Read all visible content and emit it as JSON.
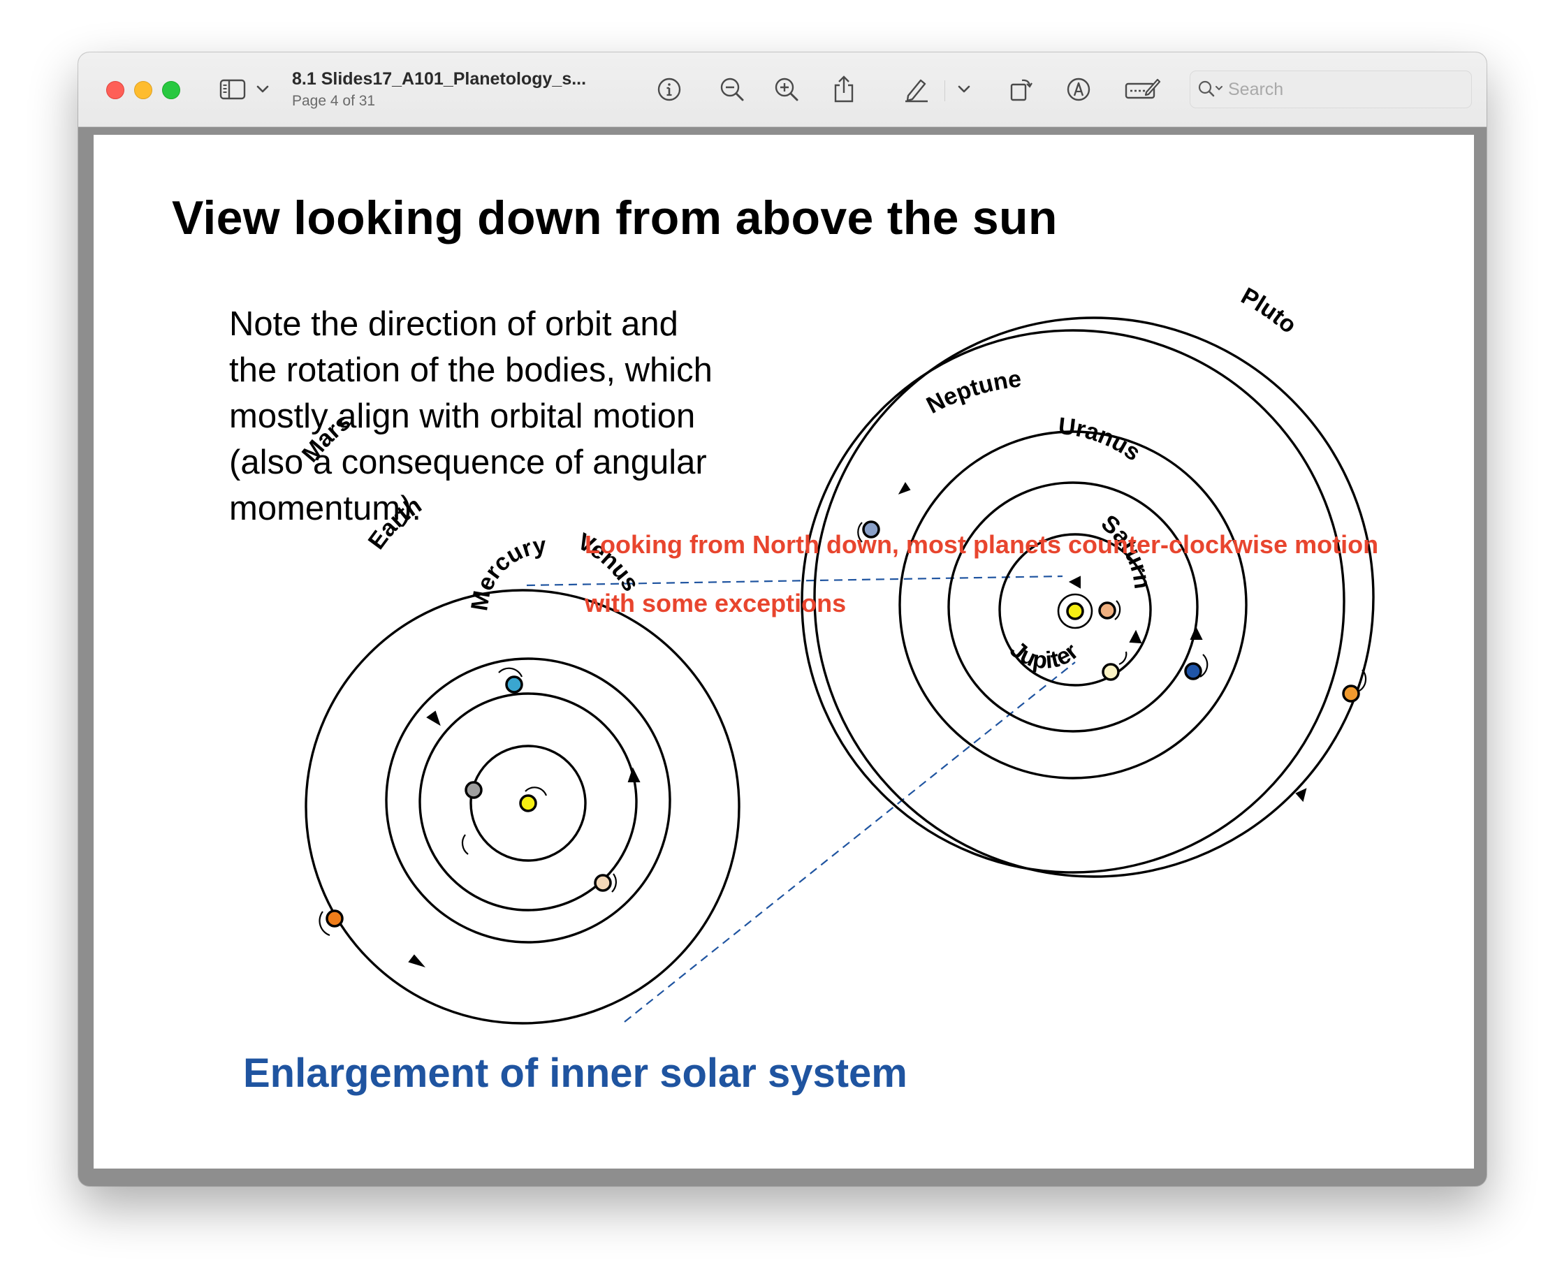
{
  "window": {
    "document_title": "8.1 Slides17_A101_Planetology_s...",
    "page_indicator": "Page 4 of 31"
  },
  "search": {
    "placeholder": "Search"
  },
  "toolbar": {
    "icons": [
      "sidebar-icon",
      "chevron-down-icon",
      "info-icon",
      "zoom-out-icon",
      "zoom-in-icon",
      "share-icon",
      "pencil-icon",
      "chevron-down-icon",
      "rotate-icon",
      "markup-icon",
      "form-fill-icon",
      "search-icon"
    ]
  },
  "slide": {
    "title": "View looking down from above the sun",
    "note_lines": [
      "Note the direction of orbit and",
      "the rotation of the bodies, which",
      "mostly align with orbital motion",
      "(also a consequence of angular",
      "momentum)."
    ],
    "annotation_line1": "Looking from North down, most planets counter-clockwise motion",
    "annotation_line2": "with some exceptions",
    "caption": "Enlargement of inner solar system",
    "planet_labels": {
      "mars": "Mars",
      "earth": "Earth",
      "venus": "Venus",
      "mercury": "Mercury",
      "pluto": "Pluto",
      "neptune": "Neptune",
      "uranus": "Uranus",
      "saturn": "Saturn",
      "jupiter": "Jupiter"
    },
    "colors": {
      "annotation": "#e8452e",
      "caption": "#1f54a0",
      "dashed_line": "#1f54a0",
      "sun": "#f5ee13",
      "mercury": "#9e9e9e",
      "venus": "#f3d8b8",
      "earth": "#3aa6d0",
      "mars": "#ef7d1a",
      "jupiter": "#fbf3c4",
      "saturn": "#f0b080",
      "uranus": "#1f55a8",
      "neptune": "#8aa0c8",
      "pluto": "#f19a2e"
    }
  }
}
